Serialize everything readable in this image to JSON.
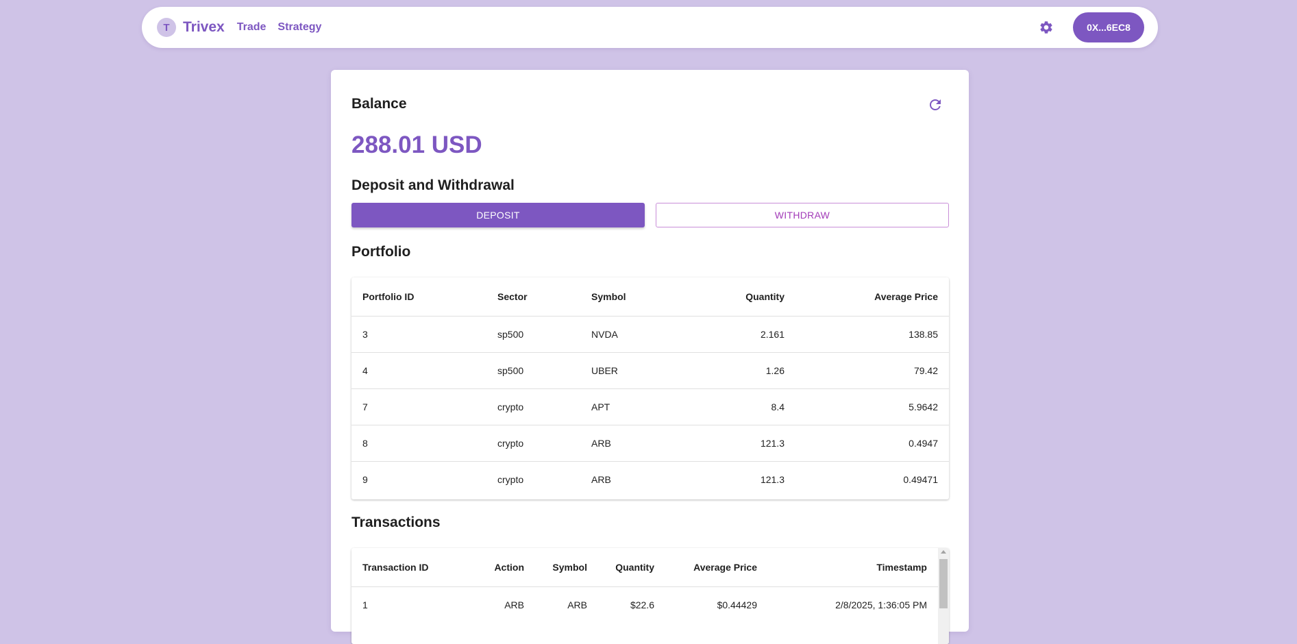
{
  "nav": {
    "logo_letter": "T",
    "brand": "Trivex",
    "links": [
      "Trade",
      "Strategy"
    ],
    "wallet": "0X...6EC8",
    "settings_icon": "gear-icon"
  },
  "balance": {
    "heading": "Balance",
    "amount": "288.01 USD",
    "refresh_icon": "refresh-icon"
  },
  "deposit_withdrawal": {
    "heading": "Deposit and Withdrawal",
    "deposit_label": "DEPOSIT",
    "withdraw_label": "WITHDRAW"
  },
  "portfolio": {
    "heading": "Portfolio",
    "columns": [
      "Portfolio ID",
      "Sector",
      "Symbol",
      "Quantity",
      "Average Price"
    ],
    "rows": [
      [
        "3",
        "sp500",
        "NVDA",
        "2.161",
        "138.85"
      ],
      [
        "4",
        "sp500",
        "UBER",
        "1.26",
        "79.42"
      ],
      [
        "7",
        "crypto",
        "APT",
        "8.4",
        "5.9642"
      ],
      [
        "8",
        "crypto",
        "ARB",
        "121.3",
        "0.4947"
      ],
      [
        "9",
        "crypto",
        "ARB",
        "121.3",
        "0.49471"
      ]
    ]
  },
  "transactions": {
    "heading": "Transactions",
    "columns": [
      "Transaction ID",
      "Action",
      "Symbol",
      "Quantity",
      "Average Price",
      "Timestamp"
    ],
    "rows": [
      [
        "1",
        "ARB",
        "ARB",
        "$22.6",
        "$0.44429",
        "2/8/2025, 1:36:05 PM"
      ]
    ]
  },
  "colors": {
    "page_bg": "#cfc3e7",
    "accent": "#7d57c1",
    "withdraw_text": "#a23ab8"
  }
}
